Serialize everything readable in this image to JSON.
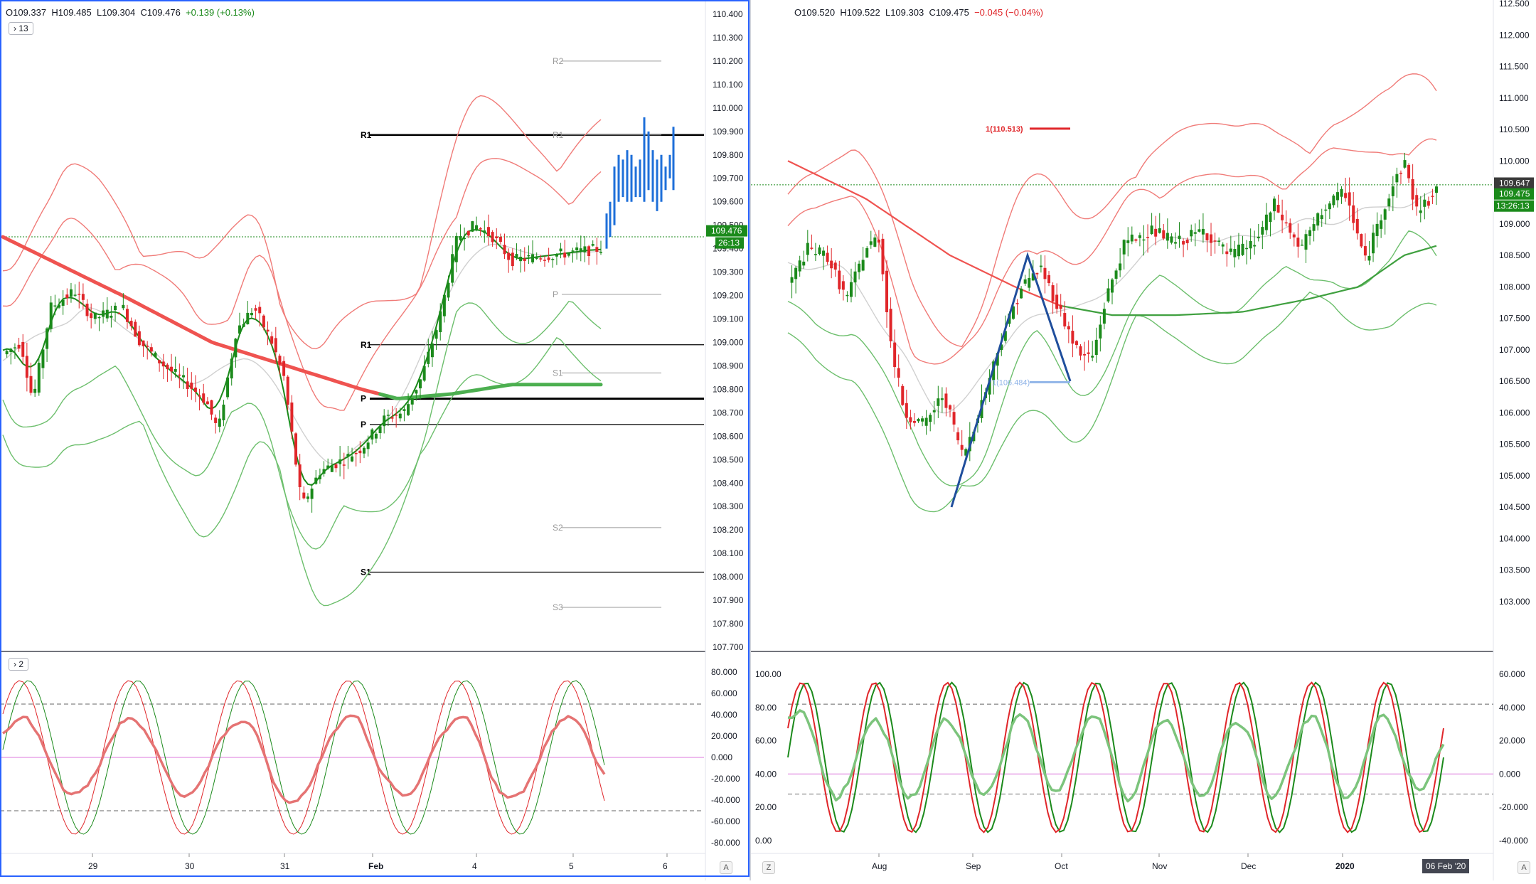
{
  "left_panel": {
    "ohlc": {
      "o": "O109.337",
      "h": "H109.485",
      "l": "L109.304",
      "c": "C109.476",
      "chg": "+0.139 (+0.13%)"
    },
    "studies_badge": "13",
    "osc_badge": "2",
    "price_axis": {
      "labels": [
        "110.400",
        "110.300",
        "110.200",
        "110.100",
        "110.000",
        "109.900",
        "109.800",
        "109.700",
        "109.600",
        "109.500",
        "109.400",
        "109.300",
        "109.200",
        "109.100",
        "109.000",
        "108.900",
        "108.800",
        "108.700",
        "108.600",
        "108.500",
        "108.400",
        "108.300",
        "108.200",
        "108.100",
        "108.000",
        "107.900",
        "107.800",
        "107.700"
      ],
      "min": 107.7,
      "max": 110.4
    },
    "last_price": "109.476",
    "countdown": "26:13",
    "osc_axis": [
      "80.000",
      "60.000",
      "40.000",
      "20.000",
      "0.000",
      "-20.000",
      "-40.000",
      "-60.000",
      "-80.000"
    ],
    "time_axis": [
      "29",
      "30",
      "31",
      "Feb",
      "4",
      "5",
      "6"
    ],
    "auto_label": "A",
    "pivots": [
      {
        "label": "R2",
        "value": 110.2
      },
      {
        "label": "R1",
        "value": 109.885
      },
      {
        "label": "R1",
        "value": 109.885
      },
      {
        "label": "P",
        "value": 109.205
      },
      {
        "label": "R1",
        "value": 108.99
      },
      {
        "label": "S1",
        "value": 108.87
      },
      {
        "label": "P",
        "value": 108.76
      },
      {
        "label": "P",
        "value": 108.65
      },
      {
        "label": "S2",
        "value": 108.21
      },
      {
        "label": "S1",
        "value": 108.02
      },
      {
        "label": "S3",
        "value": 107.87
      }
    ]
  },
  "right_panel": {
    "ohlc": {
      "o": "O109.520",
      "h": "H109.522",
      "l": "L109.303",
      "c": "C109.475",
      "chg": "−0.045 (−0.04%)"
    },
    "price_axis": {
      "labels": [
        "112.500",
        "112.000",
        "111.500",
        "111.000",
        "110.500",
        "110.000",
        "109.500",
        "109.000",
        "108.500",
        "108.000",
        "107.500",
        "107.000",
        "106.500",
        "106.000",
        "105.500",
        "105.000",
        "104.500",
        "104.000",
        "103.500",
        "103.000"
      ],
      "min": 102.5,
      "max": 112.5
    },
    "price_tag_1": "109.647",
    "last_price": "109.475",
    "countdown": "13:26:13",
    "fib_label_1": "1(110.513)",
    "fib_label_0": "1(106.484)",
    "osc_axis_left": [
      "100.00",
      "80.00",
      "60.00",
      "40.00",
      "20.00",
      "0.00"
    ],
    "osc_axis_right": [
      "60.000",
      "40.000",
      "20.000",
      "0.000",
      "-20.000",
      "-40.000"
    ],
    "time_axis": [
      "Aug",
      "Sep",
      "Oct",
      "Nov",
      "Dec",
      "2020"
    ],
    "date_tag": "06 Feb '20",
    "z_label": "Z",
    "auto_label": "A"
  },
  "chart_data": [
    {
      "type": "candlestick",
      "title": "",
      "instrument_note": "",
      "timeframe": "intraday",
      "x_labels": [
        "29",
        "30",
        "31",
        "Feb",
        "4",
        "5",
        "6"
      ],
      "ylim": [
        107.7,
        110.4
      ],
      "last_close": 109.476,
      "ohlc": {
        "open": 109.337,
        "high": 109.485,
        "low": 109.304,
        "close": 109.476
      },
      "pivot_levels": {
        "R2": 110.2,
        "R1": 109.885,
        "P": 109.205,
        "S1": 108.87,
        "S2": 108.21,
        "S3": 107.87
      },
      "oscillator": {
        "range": [
          -80,
          80
        ],
        "levels": [
          50,
          0,
          -50
        ]
      }
    },
    {
      "type": "candlestick",
      "title": "",
      "timeframe": "daily",
      "x_labels": [
        "Aug",
        "Sep",
        "Oct",
        "Nov",
        "Dec",
        "2020"
      ],
      "ylim": [
        102.5,
        112.5
      ],
      "last_close": 109.475,
      "ohlc": {
        "open": 109.52,
        "high": 109.522,
        "low": 109.303,
        "close": 109.475
      },
      "fib_levels": {
        "1": 110.513,
        "0": 106.484
      },
      "oscillator": {
        "left_range": [
          0,
          100
        ],
        "right_range": [
          -40,
          60
        ]
      }
    }
  ],
  "colors": {
    "up": "#1b8a1b",
    "down": "#e0262a",
    "band_red": "#f07b78",
    "band_green": "#6dbf6d",
    "ma_gray": "#d0d0d0",
    "accent_blue": "#1e6fd9",
    "zigzag": "#1f4e9c",
    "price_tag": "#1b8a1b"
  }
}
